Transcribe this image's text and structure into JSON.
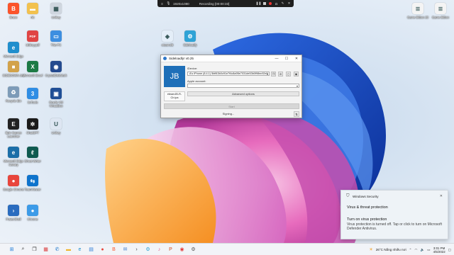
{
  "recording_bar": {
    "resolution": "1920x1080",
    "status": "Recording [00:00:33]"
  },
  "desktop_icons": {
    "left": [
      {
        "label": "Brave",
        "icon": "brave-icon",
        "color": "#fb542b",
        "glyph": "B"
      },
      {
        "label": "Microsoft Edge",
        "icon": "edge-icon",
        "color": "#1f8ecd",
        "glyph": "e"
      },
      {
        "label": "SIDEDOWN Jeo",
        "icon": "package-icon",
        "color": "#d2a24a",
        "glyph": "■"
      },
      {
        "label": "Recycle Bin",
        "icon": "recycle-bin-icon",
        "color": "#7d9bb8",
        "glyph": "♻"
      },
      {
        "label": "Epic Games Launcher",
        "icon": "epic-games-icon",
        "color": "#222222",
        "glyph": "E"
      },
      {
        "label": "Microsoft Edge Canary",
        "icon": "edge-canary-icon",
        "color": "#1b6ea8",
        "glyph": "e"
      },
      {
        "label": "Google Chrome",
        "icon": "chrome-icon",
        "color": "#e8453c",
        "glyph": "●"
      },
      {
        "label": "PowerShell",
        "icon": "powershell-icon",
        "color": "#2a6cbf",
        "glyph": "›"
      }
    ],
    "col2": [
      {
        "label": "nlc",
        "icon": "folder-icon",
        "color": "#f2c14e",
        "glyph": "▬"
      },
      {
        "label": "Ubikey.pdf",
        "icon": "pdf-icon",
        "color": "#e04444",
        "glyph": "PDF"
      },
      {
        "label": "Microsoft Excel",
        "icon": "excel-icon",
        "color": "#1d7a45",
        "glyph": "X"
      },
      {
        "label": "3uTools",
        "icon": "3utools-icon",
        "color": "#2f8de4",
        "glyph": "3"
      },
      {
        "label": "ChatGPT",
        "icon": "openai-icon",
        "color": "#1a1a1a",
        "glyph": "✲"
      },
      {
        "label": "Ghost Writer",
        "icon": "ghost-icon",
        "color": "#0f5a50",
        "glyph": "ℓ"
      },
      {
        "label": "TeamViewer",
        "icon": "teamviewer-icon",
        "color": "#0e73cc",
        "glyph": "⇆"
      },
      {
        "label": "Chrome",
        "icon": "chrome-icon-2",
        "color": "#3c9be8",
        "glyph": "●"
      }
    ],
    "col3": [
      {
        "label": "Unikey",
        "icon": "unikey-icon",
        "color": "#cfd6df",
        "glyph": "▦"
      },
      {
        "label": "This PC",
        "icon": "this-pc-icon",
        "color": "#3d8ee0",
        "glyph": "▭"
      },
      {
        "label": "CrystalDiskMark",
        "icon": "crystaldisk-icon",
        "color": "#244a8f",
        "glyph": "◉"
      },
      {
        "label": "Oracle VM VirtualBox",
        "icon": "virtualbox-icon",
        "color": "#1f4e96",
        "glyph": "▣"
      },
      {
        "label": "Unikey",
        "icon": "unikey-icon-2",
        "color": "#dde6f2",
        "glyph": "U"
      }
    ],
    "top_center": [
      {
        "label": "eteamJB",
        "icon": "ipa-file-icon",
        "color": "#e4eef8",
        "glyph": "◈"
      },
      {
        "label": "Sideloadly",
        "icon": "sideloadly-icon",
        "color": "#2fa3d6",
        "glyph": "⚙"
      }
    ],
    "top_right": [
      {
        "label": "Game Bitbox 23",
        "icon": "document-icon",
        "color": "#f4f4f4",
        "glyph": "≣"
      },
      {
        "label": "Game Bitbox",
        "icon": "document-icon-2",
        "color": "#f4f4f4",
        "glyph": "≣"
      }
    ]
  },
  "sideloadly": {
    "title": "Sideloadly! v0.25",
    "logo_text": "JB",
    "device_label": "iDevice:",
    "device_value": "A's iPhone (8.4.1) 5bff43b0c91e7f4c8a95e7031de53b0f98ec92e5",
    "account_label": "Apple account:",
    "account_value": "",
    "ipa_name": "eteamJB-R-Ch.ipa",
    "advanced_label": "Advanced options",
    "start_label": "Start",
    "status": "Signing..."
  },
  "toast": {
    "app": "Windows Security",
    "title": "Virus & threat protection",
    "heading": "Turn on virus protection",
    "body": "Virus protection is turned off. Tap or click to turn on Microsoft Defender Antivirus."
  },
  "taskbar": {
    "weather": "26°C  Nắng nhiều nơi",
    "time": "3:01 PM",
    "date": "4/5/2022",
    "pinned": [
      {
        "icon": "start-icon",
        "color": "#1f7bd6"
      },
      {
        "icon": "search-icon",
        "color": "#333333"
      },
      {
        "icon": "task-view-icon",
        "color": "#333333"
      },
      {
        "icon": "widgets-icon",
        "color": "#d93c3c"
      },
      {
        "icon": "chat-icon",
        "color": "#1a73c9"
      },
      {
        "icon": "file-explorer-icon",
        "color": "#f0b429"
      },
      {
        "icon": "edge-taskbar-icon",
        "color": "#1f8ecd"
      },
      {
        "icon": "store-icon",
        "color": "#2d7bd6"
      },
      {
        "icon": "chrome-taskbar-icon",
        "color": "#e8453c"
      },
      {
        "icon": "brave-taskbar-icon",
        "color": "#fb542b"
      },
      {
        "icon": "mail-icon",
        "color": "#3d7ac9"
      },
      {
        "icon": "terminal-icon",
        "color": "#333333"
      },
      {
        "icon": "sideloadly-taskbar-icon",
        "color": "#2fa3d6"
      },
      {
        "icon": "itunes-icon",
        "color": "#e44d80"
      },
      {
        "icon": "powerpoint-icon",
        "color": "#d04a22"
      },
      {
        "icon": "screen-recorder-icon",
        "color": "#e33b3b"
      },
      {
        "icon": "settings-icon",
        "color": "#555555"
      }
    ]
  }
}
